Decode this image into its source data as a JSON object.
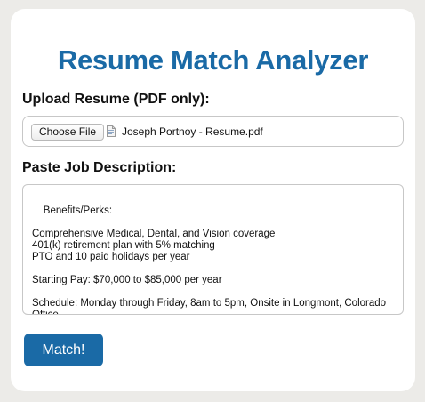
{
  "page": {
    "title": "Resume Match Analyzer"
  },
  "upload": {
    "label": "Upload Resume (PDF only):",
    "button_label": "Choose File",
    "file_name": "Joseph Portnoy - Resume.pdf",
    "file_icon": "pdf-file-icon"
  },
  "job_description": {
    "label": "Paste Job Description:",
    "value": "Benefits/Perks:\n\nComprehensive Medical, Dental, and Vision coverage\n401(k) retirement plan with 5% matching\nPTO and 10 paid holidays per year\n\nStarting Pay: $70,000 to $85,000 per year\n\nSchedule: Monday through Friday, 8am to 5pm, Onsite in Longmont, Colorado Office"
  },
  "actions": {
    "match_label": "Match!"
  },
  "colors": {
    "accent": "#1a6aa6",
    "background": "#ecebe8",
    "card": "#ffffff"
  }
}
